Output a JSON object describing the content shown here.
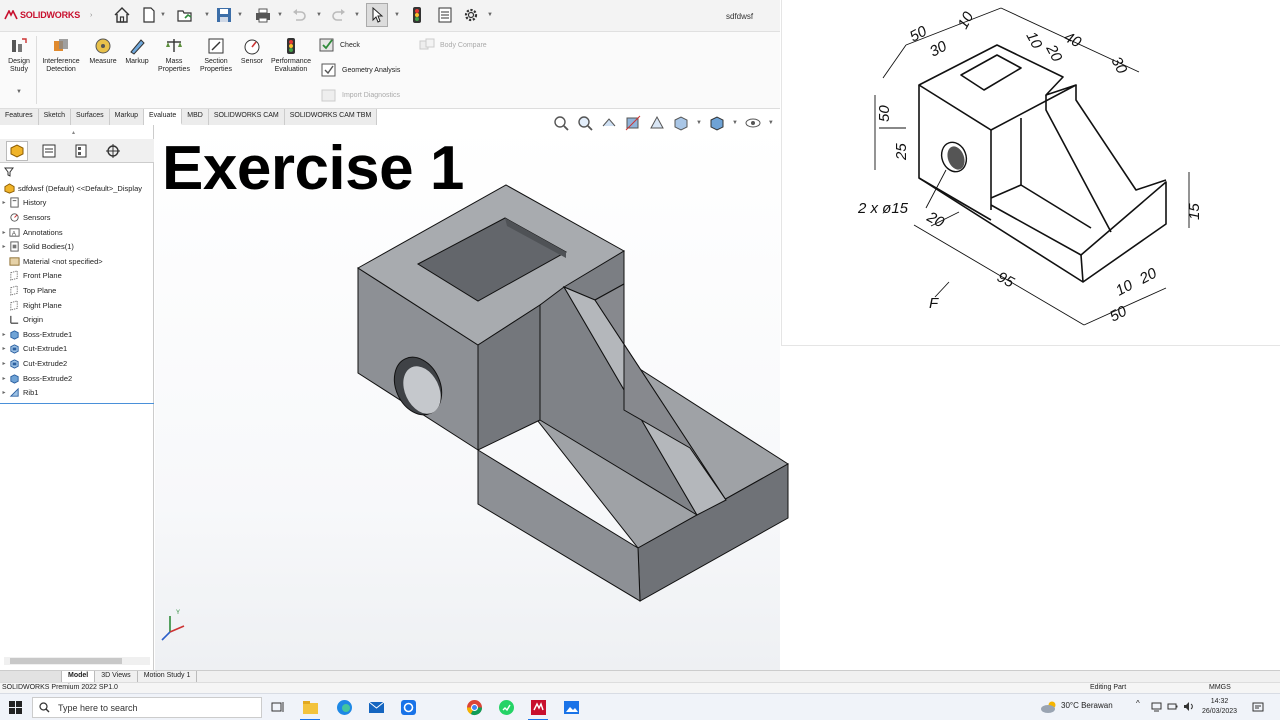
{
  "app": {
    "logo_ds": "3DS",
    "logo_text": "SOLIDWORKS",
    "document_title": "sdfdwsf"
  },
  "command_manager": {
    "tools": [
      {
        "label_1": "Design",
        "label_2": "Study",
        "icon": "design-study-icon"
      },
      {
        "label_1": "Interference",
        "label_2": "Detection",
        "icon": "interference-detection-icon"
      },
      {
        "label_1": "Measure",
        "label_2": "",
        "icon": "measure-icon"
      },
      {
        "label_1": "Markup",
        "label_2": "",
        "icon": "markup-icon"
      },
      {
        "label_1": "Mass",
        "label_2": "Properties",
        "icon": "mass-properties-icon"
      },
      {
        "label_1": "Section",
        "label_2": "Properties",
        "icon": "section-properties-icon"
      },
      {
        "label_1": "Sensor",
        "label_2": "",
        "icon": "sensor-icon"
      },
      {
        "label_1": "Performance",
        "label_2": "Evaluation",
        "icon": "performance-evaluation-icon"
      }
    ],
    "check": "Check",
    "geometry_analysis": "Geometry Analysis",
    "import_diagnostics": "Import Diagnostics",
    "body_compare": "Body Compare"
  },
  "tabs": [
    "Features",
    "Sketch",
    "Surfaces",
    "Markup",
    "Evaluate",
    "MBD",
    "SOLIDWORKS CAM",
    "SOLIDWORKS CAM TBM"
  ],
  "active_tab": "Evaluate",
  "feature_tree": {
    "root": "sdfdwsf (Default) <<Default>_Display",
    "items": [
      {
        "label": "History",
        "expandable": true,
        "icon": "history-icon"
      },
      {
        "label": "Sensors",
        "expandable": false,
        "icon": "sensors-icon"
      },
      {
        "label": "Annotations",
        "expandable": true,
        "icon": "annotations-icon"
      },
      {
        "label": "Solid Bodies(1)",
        "expandable": true,
        "icon": "solid-bodies-icon"
      },
      {
        "label": "Material <not specified>",
        "expandable": false,
        "icon": "material-icon"
      },
      {
        "label": "Front Plane",
        "expandable": false,
        "icon": "plane-icon"
      },
      {
        "label": "Top Plane",
        "expandable": false,
        "icon": "plane-icon"
      },
      {
        "label": "Right Plane",
        "expandable": false,
        "icon": "plane-icon"
      },
      {
        "label": "Origin",
        "expandable": false,
        "icon": "origin-icon"
      },
      {
        "label": "Boss-Extrude1",
        "expandable": true,
        "icon": "extrude-icon"
      },
      {
        "label": "Cut-Extrude1",
        "expandable": true,
        "icon": "cut-extrude-icon"
      },
      {
        "label": "Cut-Extrude2",
        "expandable": true,
        "icon": "cut-extrude-icon"
      },
      {
        "label": "Boss-Extrude2",
        "expandable": true,
        "icon": "extrude-icon"
      },
      {
        "label": "Rib1",
        "expandable": true,
        "icon": "rib-icon"
      }
    ]
  },
  "graphics": {
    "overlay_title": "Exercise 1"
  },
  "reference_drawing": {
    "dims": {
      "d50_top": "50",
      "d30": "30",
      "d10_a": "10",
      "d10_b": "10",
      "d20_top": "20",
      "d40": "40",
      "d30_right": "30",
      "d50_left": "50",
      "d25": "25",
      "hole": "2 x ø15",
      "d20_left": "20",
      "d95": "95",
      "d15": "15",
      "d10_bottom": "10",
      "d20_bottom": "20",
      "d50_bottom": "50",
      "arrow_label": "F"
    }
  },
  "bottom_tabs": [
    "Model",
    "3D Views",
    "Motion Study 1"
  ],
  "status": {
    "left": "SOLIDWORKS Premium 2022 SP1.0",
    "mode": "Editing Part",
    "units": "MMGS"
  },
  "taskbar": {
    "search_placeholder": "Type here to search",
    "weather": "30°C  Berawan",
    "time": "14:32",
    "date": "26/03/2023"
  }
}
